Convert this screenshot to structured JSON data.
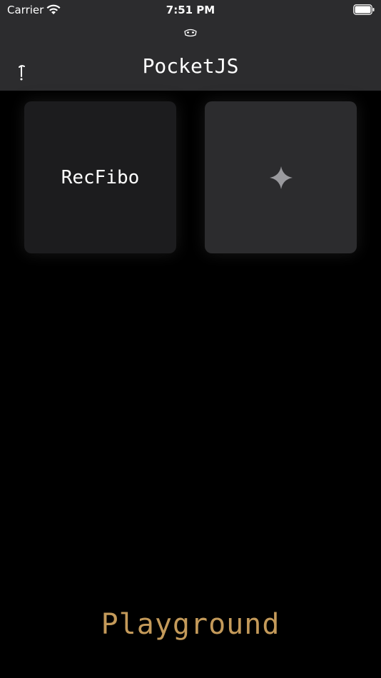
{
  "status_bar": {
    "carrier": "Carrier",
    "time": "7:51 PM",
    "wifi_icon": "wifi-icon",
    "battery_icon": "battery-icon"
  },
  "nav": {
    "title": "PocketJS",
    "logo_icon": "mask-icon",
    "info_icon": "info-icon"
  },
  "projects": [
    {
      "label": "RecFibo"
    }
  ],
  "add_card": {
    "icon": "plus-icon"
  },
  "footer": {
    "label": "Playground"
  },
  "colors": {
    "background": "#000000",
    "bar": "#2c2c2e",
    "card": "#1c1c1e",
    "add_card": "#2c2c2e",
    "accent": "#c49a5a",
    "plus": "#9a9a9e"
  }
}
